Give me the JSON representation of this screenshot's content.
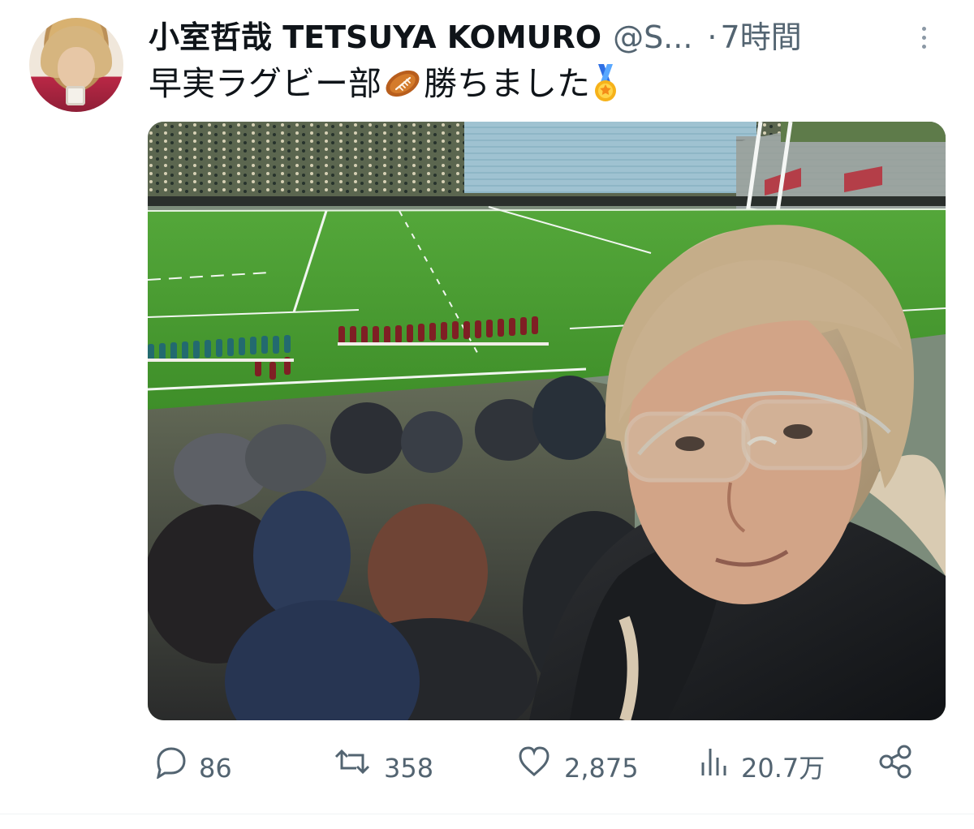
{
  "post": {
    "author": {
      "display_name": "小室哲哉 TETSUYA KOMURO",
      "handle": "@S...",
      "separator": "·",
      "time": "7時間"
    },
    "text": {
      "part1": "早実ラグビー部",
      "part2": "勝ちました"
    },
    "emojis": {
      "rugby": "rugby-football-icon",
      "medal": "sports-medal-icon"
    },
    "media": {
      "alt": "Selfie at a rugby stadium with players lined up on the field"
    },
    "actions": {
      "replies": "86",
      "reposts": "358",
      "likes": "2,875",
      "views": "20.7万"
    },
    "icons": {
      "reply": "comment-icon",
      "repost": "repost-icon",
      "like": "heart-icon",
      "views": "views-icon",
      "share": "share-icon",
      "more": "more-icon"
    },
    "colors": {
      "text": "#0f1419",
      "secondary": "#536471",
      "field": "#4f9b2f",
      "divider": "#eff3f4"
    }
  }
}
